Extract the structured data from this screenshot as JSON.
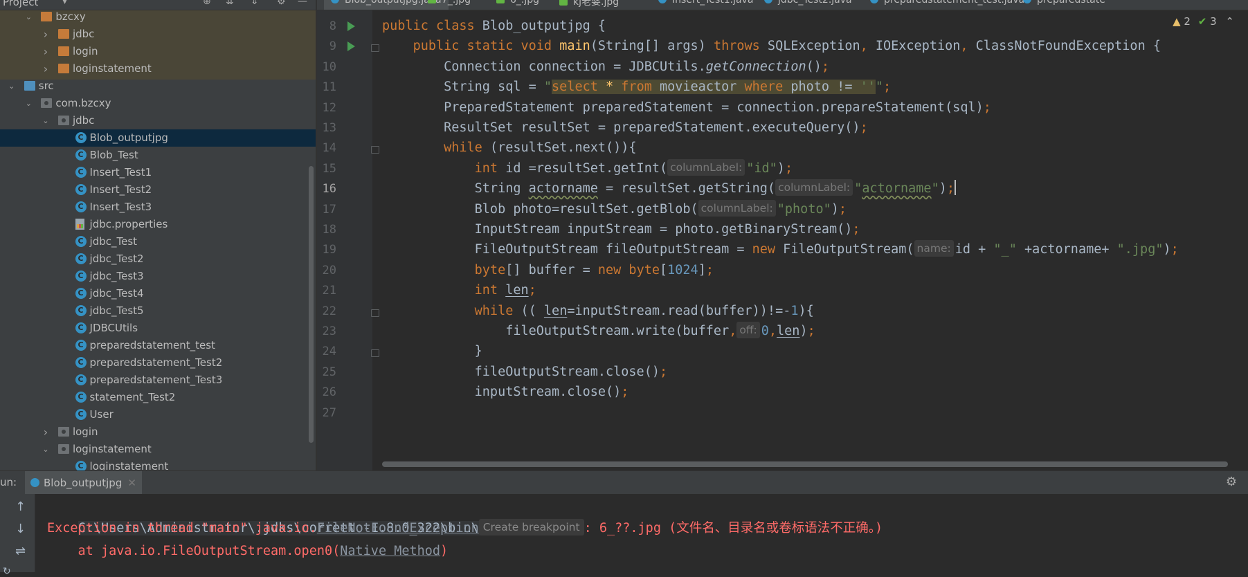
{
  "project_panel": {
    "title": "Project",
    "tree": [
      {
        "label": "bzcxy",
        "icon": "folder-orange",
        "arrow": "expanded",
        "indent": 1
      },
      {
        "label": "jdbc",
        "icon": "folder-orange",
        "arrow": "collapsed",
        "indent": 2
      },
      {
        "label": "login",
        "icon": "folder-orange",
        "arrow": "collapsed",
        "indent": 2
      },
      {
        "label": "loginstatement",
        "icon": "folder-orange",
        "arrow": "collapsed",
        "indent": 2
      },
      {
        "label": "src",
        "icon": "folder-blue",
        "arrow": "expanded",
        "indent": 0
      },
      {
        "label": "com.bzcxy",
        "icon": "package",
        "arrow": "expanded",
        "indent": 1
      },
      {
        "label": "jdbc",
        "icon": "package",
        "arrow": "expanded",
        "indent": 2
      },
      {
        "label": "Blob_outputjpg",
        "icon": "class",
        "indent": 3,
        "selected": true
      },
      {
        "label": "Blob_Test",
        "icon": "class",
        "indent": 3
      },
      {
        "label": "Insert_Test1",
        "icon": "class",
        "indent": 3
      },
      {
        "label": "Insert_Test2",
        "icon": "class",
        "indent": 3
      },
      {
        "label": "Insert_Test3",
        "icon": "class",
        "indent": 3
      },
      {
        "label": "jdbc.properties",
        "icon": "properties",
        "indent": 3
      },
      {
        "label": "jdbc_Test",
        "icon": "class",
        "indent": 3
      },
      {
        "label": "jdbc_Test2",
        "icon": "class",
        "indent": 3
      },
      {
        "label": "jdbc_Test3",
        "icon": "class",
        "indent": 3
      },
      {
        "label": "jdbc_Test4",
        "icon": "class",
        "indent": 3
      },
      {
        "label": "jdbc_Test5",
        "icon": "class",
        "indent": 3
      },
      {
        "label": "JDBCUtils",
        "icon": "class",
        "indent": 3
      },
      {
        "label": "preparedstatement_test",
        "icon": "class",
        "indent": 3
      },
      {
        "label": "preparedstatement_Test2",
        "icon": "class",
        "indent": 3
      },
      {
        "label": "preparedstatement_Test3",
        "icon": "class",
        "indent": 3
      },
      {
        "label": "statement_Test2",
        "icon": "class",
        "indent": 3
      },
      {
        "label": "User",
        "icon": "class",
        "indent": 3
      },
      {
        "label": "login",
        "icon": "package",
        "arrow": "collapsed",
        "indent": 2
      },
      {
        "label": "loginstatement",
        "icon": "package",
        "arrow": "expanded",
        "indent": 2
      },
      {
        "label": "loginstatement",
        "icon": "class",
        "indent": 3
      }
    ]
  },
  "tabs": [
    {
      "label": "Blob_outputjpg.java",
      "icon": "class",
      "active": true
    },
    {
      "label": "7_.jpg",
      "icon": "image"
    },
    {
      "label": "6_.jpg",
      "icon": "image"
    },
    {
      "label": "kj老婆.jpg",
      "icon": "image"
    },
    {
      "label": "Insert_Test1.java",
      "icon": "class"
    },
    {
      "label": "jdbc_Test2.java",
      "icon": "class"
    },
    {
      "label": "preparedstatement_test.java",
      "icon": "class"
    },
    {
      "label": "preparedstate",
      "icon": "class"
    }
  ],
  "inspections": {
    "warnings": "2",
    "ok": "3"
  },
  "editor": {
    "current_line": 16,
    "lines": [
      {
        "n": 8,
        "html": "<span class='kw'>public class</span> Blob_outputjpg {"
      },
      {
        "n": 9,
        "html": "    <span class='kw'>public static void</span> <span class='fn'>main</span>(String[] args) <span class='kw'>throws</span> SQLException<span class='kw'>,</span> IOException<span class='kw'>,</span> ClassNotFoundException {"
      },
      {
        "n": 10,
        "html": "        Connection connection = JDBCUtils.<span class='it'>getConnection</span>()<span class='kw'>;</span>"
      },
      {
        "n": 11,
        "html": "        String sql = <span class='str'>\"</span><span class='hl'><span class='sqlkw'>select</span> <span class='fn'>*</span> <span class='sqlkw'>from</span> movieactor <span class='sqlkw'>where</span> photo != <span class='str'>''</span></span><span class='str'>\"</span><span class='kw'>;</span>"
      },
      {
        "n": 12,
        "html": "        PreparedStatement preparedStatement = connection.prepareStatement(sql)<span class='kw'>;</span>"
      },
      {
        "n": 13,
        "html": "        ResultSet resultSet = preparedStatement.executeQuery()<span class='kw'>;</span>"
      },
      {
        "n": 14,
        "html": "        <span class='kw'>while</span> (resultSet.next()){"
      },
      {
        "n": 15,
        "html": "            <span class='kw'>int</span> id =resultSet.getInt(<span class='hint'>columnLabel:</span><span class='str'>\"id\"</span>)<span class='kw'>;</span>"
      },
      {
        "n": 16,
        "html": "            String <span class='squig'>actorname</span> = resultSet.getString(<span class='hint'>columnLabel:</span><span class='str'>\"<span class='squig'>actorname</span>\"</span>)<span class='kw'>;</span><span class='caret'></span>"
      },
      {
        "n": 17,
        "html": "            Blob photo=resultSet.getBlob(<span class='hint'>columnLabel:</span><span class='str'>\"photo\"</span>)<span class='kw'>;</span>"
      },
      {
        "n": 18,
        "html": "            InputStream inputStream = photo.getBinaryStream()<span class='kw'>;</span>"
      },
      {
        "n": 19,
        "html": "            FileOutputStream fileOutputStream = <span class='kw'>new</span> FileOutputStream(<span class='hint'>name:</span>id + <span class='str'>\"_\"</span> +actorname+ <span class='str'>\".jpg\"</span>)<span class='kw'>;</span>"
      },
      {
        "n": 20,
        "html": "            <span class='kw'>byte</span>[] buffer = <span class='kw'>new byte</span>[<span class='num'>1024</span>]<span class='kw'>;</span>"
      },
      {
        "n": 21,
        "html": "            <span class='kw'>int</span> <span class='ul'>len</span><span class='kw'>;</span>"
      },
      {
        "n": 22,
        "html": "            <span class='kw'>while</span> (( <span class='ul'>len</span>=inputStream.read(buffer))!=-<span class='num'>1</span>){"
      },
      {
        "n": 23,
        "html": "                fileOutputStream.write(buffer<span class='kw'>,</span><span class='hint'>off:</span><span class='num'>0</span><span class='kw'>,</span><span class='ul'>len</span>)<span class='kw'>;</span>"
      },
      {
        "n": 24,
        "html": "            }"
      },
      {
        "n": 25,
        "html": "            fileOutputStream.close()<span class='kw'>;</span>"
      },
      {
        "n": 26,
        "html": "            inputStream.close()<span class='kw'>;</span>"
      },
      {
        "n": 27,
        "html": ""
      }
    ]
  },
  "run_panel": {
    "label": "un:",
    "tab": "Blob_outputjpg",
    "console": {
      "cmd": "C:\\Users\\Administrator\\.jdks\\corretto-1.8.0_322\\bin\\java.exe ...",
      "err_prefix": "Exception in thread \"main\" java.io.",
      "err_class": "FileNotFoundException",
      "err_hint": "Create breakpoint",
      "err_suffix": ": 6_??.jpg (文件名、目录名或卷标语法不正确。)",
      "stack_prefix": "    at java.io.FileOutputStream.open0(",
      "stack_link": "Native Method",
      "stack_suffix": ")"
    }
  }
}
